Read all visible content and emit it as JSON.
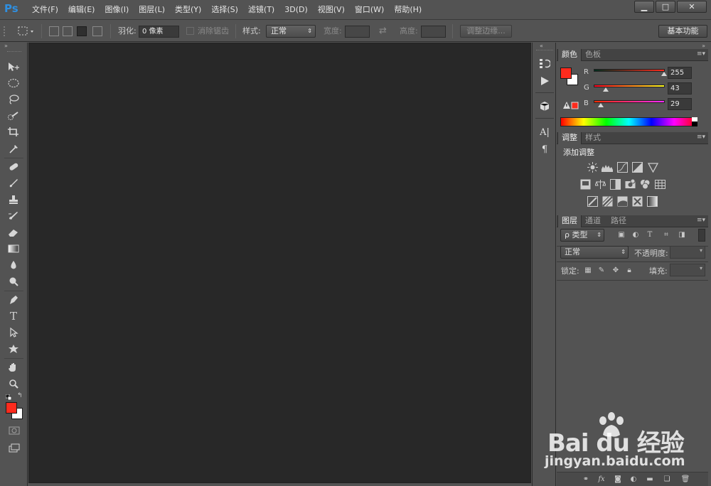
{
  "app": {
    "logo": "Ps"
  },
  "menu": [
    "文件(F)",
    "编辑(E)",
    "图像(I)",
    "图层(L)",
    "类型(Y)",
    "选择(S)",
    "滤镜(T)",
    "3D(D)",
    "视图(V)",
    "窗口(W)",
    "帮助(H)"
  ],
  "window_controls": {
    "minimize": "▁",
    "maximize": "□",
    "close": "✕"
  },
  "options": {
    "feather_label": "羽化:",
    "feather_value": "0 像素",
    "antialias_label": "消除锯齿",
    "style_label": "样式:",
    "style_value": "正常",
    "width_label": "宽度:",
    "height_label": "高度:",
    "refine_edge": "调整边缘...",
    "workspace": "基本功能"
  },
  "tools": [
    "move-tool",
    "marquee-tool",
    "lasso-tool",
    "quick-select-tool",
    "crop-tool",
    "eyedropper-tool",
    "healing-brush-tool",
    "brush-tool",
    "clone-stamp-tool",
    "history-brush-tool",
    "eraser-tool",
    "gradient-tool",
    "blur-tool",
    "dodge-tool",
    "pen-tool",
    "type-tool",
    "path-select-tool",
    "shape-tool",
    "hand-tool",
    "zoom-tool"
  ],
  "color_panel": {
    "tabs": [
      "颜色",
      "色板"
    ],
    "channels": [
      {
        "label": "R",
        "value": "255"
      },
      {
        "label": "G",
        "value": "43"
      },
      {
        "label": "B",
        "value": "29"
      }
    ],
    "foreground": "#ff2b1d",
    "background": "#ffffff"
  },
  "adjust_panel": {
    "tabs": [
      "调整",
      "样式"
    ],
    "title": "添加调整"
  },
  "layers_panel": {
    "tabs": [
      "图层",
      "通道",
      "路径"
    ],
    "filter": "ρ 类型",
    "blend": "正常",
    "opacity_label": "不透明度:",
    "lock_label": "锁定:",
    "fill_label": "填充:"
  },
  "watermark": {
    "brand": "Bai du 经验",
    "url": "jingyan.baidu.com"
  }
}
